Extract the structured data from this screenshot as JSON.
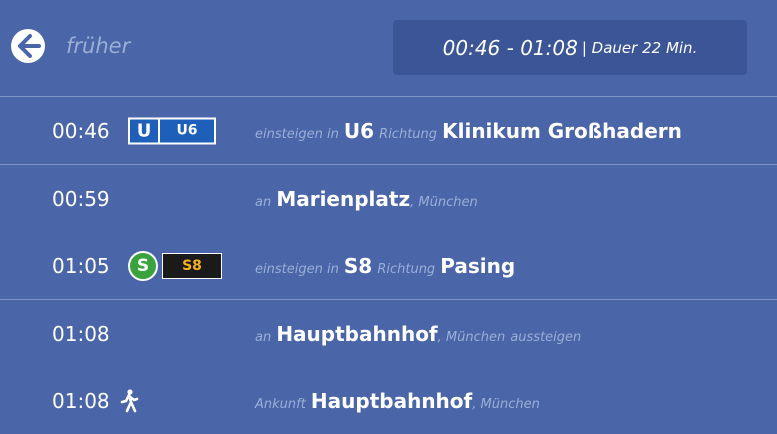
{
  "header": {
    "earlier_label": "früher",
    "summary_times": "00:46 - 01:08",
    "summary_duration": "| Dauer 22 Min."
  },
  "rows": [
    {
      "time": "00:46",
      "badge": {
        "mode": "U",
        "line": "U6"
      },
      "action": "einsteigen in",
      "line": "U6",
      "direction_word": "Richtung",
      "direction": "Klinikum Großhadern"
    },
    {
      "time": "00:59",
      "action": "an",
      "station": "Marienplatz",
      "city": ", München"
    },
    {
      "time": "01:05",
      "badge": {
        "mode": "S",
        "line": "S8"
      },
      "action": "einsteigen in",
      "line": "S8",
      "direction_word": "Richtung",
      "direction": "Pasing"
    },
    {
      "time": "01:08",
      "action": "an",
      "station": "Hauptbahnhof",
      "city": ", München",
      "suffix": "aussteigen"
    },
    {
      "time": "01:08",
      "icon": "walking-person-icon",
      "action": "Ankunft",
      "station": "Hauptbahnhof",
      "city": ", München"
    }
  ],
  "colors": {
    "background": "#4a66a8",
    "summary_box": "#3b5596",
    "muted_text": "#9aaed6",
    "ubahn_blue": "#1d5fb9",
    "sbahn_green": "#3aa33e",
    "s8_line_text": "#f5b11a"
  }
}
